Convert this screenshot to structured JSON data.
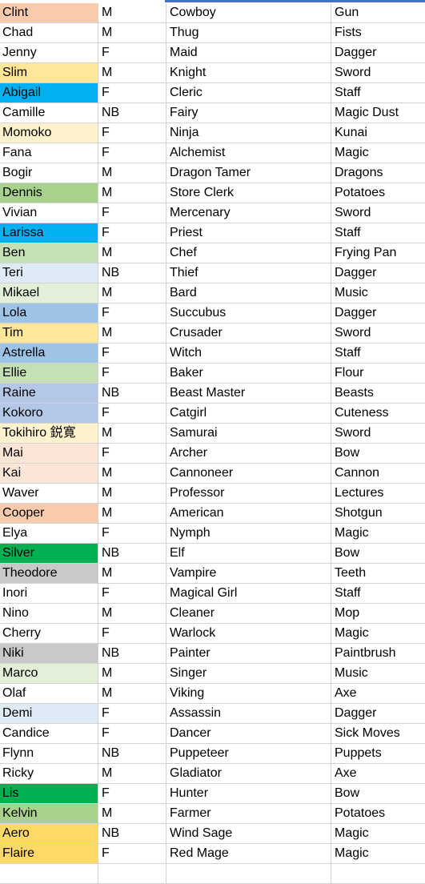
{
  "sheet": {
    "rows": [
      {
        "name": "Clint",
        "gender": "M",
        "class": "Cowboy",
        "weapon": "Gun",
        "color": "#f8cbad"
      },
      {
        "name": "Chad",
        "gender": "M",
        "class": "Thug",
        "weapon": "Fists",
        "color": ""
      },
      {
        "name": "Jenny",
        "gender": "F",
        "class": "Maid",
        "weapon": "Dagger",
        "color": ""
      },
      {
        "name": "Slim",
        "gender": "M",
        "class": "Knight",
        "weapon": "Sword",
        "color": "#ffe699"
      },
      {
        "name": "Abigail",
        "gender": "F",
        "class": "Cleric",
        "weapon": "Staff",
        "color": "#00b0f0"
      },
      {
        "name": "Camille",
        "gender": "NB",
        "class": "Fairy",
        "weapon": "Magic Dust",
        "color": ""
      },
      {
        "name": "Momoko",
        "gender": "F",
        "class": "Ninja",
        "weapon": "Kunai",
        "color": "#fff2cc"
      },
      {
        "name": "Fana",
        "gender": "F",
        "class": "Alchemist",
        "weapon": "Magic",
        "color": ""
      },
      {
        "name": "Bogir",
        "gender": "M",
        "class": "Dragon Tamer",
        "weapon": "Dragons",
        "color": ""
      },
      {
        "name": "Dennis",
        "gender": "M",
        "class": "Store Clerk",
        "weapon": "Potatoes",
        "color": "#a9d18e"
      },
      {
        "name": "Vivian",
        "gender": "F",
        "class": "Mercenary",
        "weapon": "Sword",
        "color": ""
      },
      {
        "name": "Larissa",
        "gender": "F",
        "class": "Priest",
        "weapon": "Staff",
        "color": "#00b0f0"
      },
      {
        "name": "Ben",
        "gender": "M",
        "class": "Chef",
        "weapon": "Frying Pan",
        "color": "#c5e0b4"
      },
      {
        "name": "Teri",
        "gender": "NB",
        "class": "Thief",
        "weapon": "Dagger",
        "color": "#deebf7"
      },
      {
        "name": "Mikael",
        "gender": "M",
        "class": "Bard",
        "weapon": "Music",
        "color": "#e2f0d9"
      },
      {
        "name": "Lola",
        "gender": "F",
        "class": "Succubus",
        "weapon": "Dagger",
        "color": "#9dc3e6"
      },
      {
        "name": "Tim",
        "gender": "M",
        "class": "Crusader",
        "weapon": "Sword",
        "color": "#ffe699"
      },
      {
        "name": "Astrella",
        "gender": "F",
        "class": "Witch",
        "weapon": "Staff",
        "color": "#9dc3e6"
      },
      {
        "name": "Ellie",
        "gender": "F",
        "class": "Baker",
        "weapon": "Flour",
        "color": "#c5e0b4"
      },
      {
        "name": "Raine",
        "gender": "NB",
        "class": "Beast Master",
        "weapon": "Beasts",
        "color": "#b4c7e7"
      },
      {
        "name": "Kokoro",
        "gender": "F",
        "class": "Catgirl",
        "weapon": "Cuteness",
        "color": "#b4c7e7"
      },
      {
        "name": "Tokihiro 鋭寛",
        "gender": "M",
        "class": "Samurai",
        "weapon": "Sword",
        "color": "#fff2cc"
      },
      {
        "name": "Mai",
        "gender": "F",
        "class": "Archer",
        "weapon": "Bow",
        "color": "#fbe5d6"
      },
      {
        "name": "Kai",
        "gender": "M",
        "class": "Cannoneer",
        "weapon": "Cannon",
        "color": "#fbe5d6"
      },
      {
        "name": "Waver",
        "gender": "M",
        "class": "Professor",
        "weapon": "Lectures",
        "color": ""
      },
      {
        "name": "Cooper",
        "gender": "M",
        "class": "American",
        "weapon": "Shotgun",
        "color": "#f8cbad"
      },
      {
        "name": "Elya",
        "gender": "F",
        "class": "Nymph",
        "weapon": "Magic",
        "color": ""
      },
      {
        "name": "Silver",
        "gender": "NB",
        "class": "Elf",
        "weapon": "Bow",
        "color": "#00b050"
      },
      {
        "name": "Theodore",
        "gender": "M",
        "class": "Vampire",
        "weapon": "Teeth",
        "color": "#c9c9c9"
      },
      {
        "name": "Inori",
        "gender": "F",
        "class": "Magical Girl",
        "weapon": "Staff",
        "color": ""
      },
      {
        "name": "Nino",
        "gender": "M",
        "class": "Cleaner",
        "weapon": "Mop",
        "color": ""
      },
      {
        "name": "Cherry",
        "gender": "F",
        "class": "Warlock",
        "weapon": "Magic",
        "color": ""
      },
      {
        "name": "Niki",
        "gender": "NB",
        "class": "Painter",
        "weapon": "Paintbrush",
        "color": "#c9c9c9"
      },
      {
        "name": "Marco",
        "gender": "M",
        "class": "Singer",
        "weapon": "Music",
        "color": "#e2f0d9"
      },
      {
        "name": "Olaf",
        "gender": "M",
        "class": "Viking",
        "weapon": "Axe",
        "color": ""
      },
      {
        "name": "Demi",
        "gender": "F",
        "class": "Assassin",
        "weapon": "Dagger",
        "color": "#deebf7"
      },
      {
        "name": "Candice",
        "gender": "F",
        "class": "Dancer",
        "weapon": "Sick Moves",
        "color": ""
      },
      {
        "name": "Flynn",
        "gender": "NB",
        "class": "Puppeteer",
        "weapon": "Puppets",
        "color": ""
      },
      {
        "name": "Ricky",
        "gender": "M",
        "class": "Gladiator",
        "weapon": "Axe",
        "color": ""
      },
      {
        "name": "Lis",
        "gender": "F",
        "class": "Hunter",
        "weapon": "Bow",
        "color": "#00b050"
      },
      {
        "name": "Kelvin",
        "gender": "M",
        "class": "Farmer",
        "weapon": "Potatoes",
        "color": "#a9d18e"
      },
      {
        "name": "Aero",
        "gender": "NB",
        "class": "Wind Sage",
        "weapon": "Magic",
        "color": "#ffd966"
      },
      {
        "name": "Flaire",
        "gender": "F",
        "class": "Red Mage",
        "weapon": "Magic",
        "color": "#ffd966"
      }
    ],
    "header_accent_color": "#4472c4",
    "gridline_color": "#d4d4d4"
  }
}
